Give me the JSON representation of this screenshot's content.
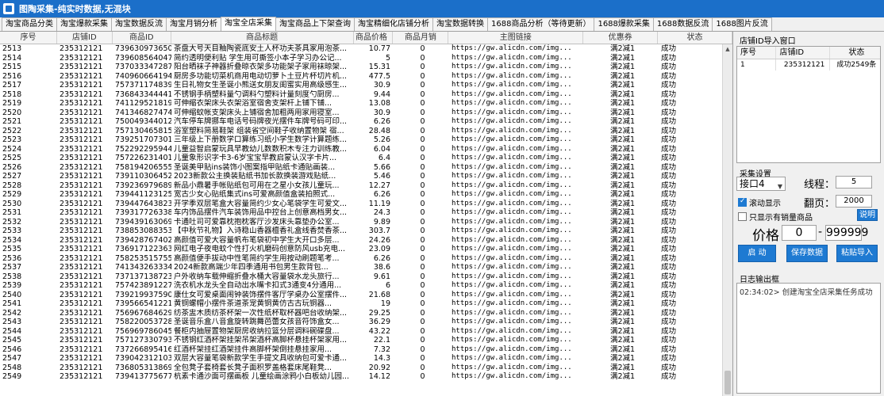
{
  "window": {
    "title": "图陶采集-纯实时数据,无混块"
  },
  "tabs": [
    "淘宝商品分类",
    "淘宝爆款采集",
    "淘宝数据反流",
    "淘宝月销分析",
    "淘宝全店采集",
    "淘宝商品上下架查询",
    "淘宝精细化店铺分析",
    "淘宝数据转换",
    "1688商品分析（等待更新）",
    "1688爆款采集",
    "1688数据反流",
    "1688图片反流"
  ],
  "grid": {
    "columns": [
      "序号",
      "店铺ID",
      "商品ID",
      "商品标题",
      "商品价格",
      "商品月销",
      "主图链接",
      "优惠券",
      "状态"
    ],
    "rows": [
      [
        "2513",
        "235312121",
        "739630973650",
        "茶盘大号天目釉陶瓷底安土人杯功夫茶具家用泡茶...",
        "10.77",
        "0",
        "https://gw.alicdn.com/img...",
        "满2减1",
        "成功"
      ],
      [
        "2514",
        "235312121",
        "739608564047",
        "简约透明便利贴 学生用可撕签小本子学习办公记...",
        "5",
        "0",
        "https://gw.alicdn.com/img...",
        "满2减1",
        "成功"
      ],
      [
        "2515",
        "235312121",
        "737033347287",
        "阳台晒袜子神器折叠晾衣架多功能架子家用袜晾架...",
        "15.31",
        "0",
        "https://gw.alicdn.com/img...",
        "满2减1",
        "成功"
      ],
      [
        "2516",
        "235312121",
        "740960664194",
        "厨房多功能切菜机商用电动切萝卜土豆片杯切片机...",
        "477.5",
        "0",
        "https://gw.alicdn.com/img...",
        "满2减1",
        "成功"
      ],
      [
        "2517",
        "235312121",
        "757371174839",
        "生日礼物女生圣诞小熊送女朋友闺蜜实用高级感生...",
        "30.9",
        "0",
        "https://gw.alicdn.com/img...",
        "满2减1",
        "成功"
      ],
      [
        "2518",
        "235312121",
        "736843344441",
        "不锈钢手柄塑料量勺调料勺塑料计量刻度勺厨房...",
        "9.44",
        "0",
        "https://gw.alicdn.com/img...",
        "满2减1",
        "成功"
      ],
      [
        "2519",
        "235312121",
        "741129521819",
        "可伸缩衣架床头衣架浴室宿舍支架杆上铺下铺...",
        "13.08",
        "0",
        "https://gw.alicdn.com/img...",
        "满2减1",
        "成功"
      ],
      [
        "2520",
        "235312121",
        "741346827474",
        "可伸缩蚊帐支架床头上铺宿舍加粗两用家用寝室...",
        "30.9",
        "0",
        "https://gw.alicdn.com/img...",
        "满2减1",
        "成功"
      ],
      [
        "2521",
        "235312121",
        "750049344012",
        "汽车停车牌挪车电话号码牌夜光摆件车牌号码可印...",
        "6.26",
        "0",
        "https://gw.alicdn.com/img...",
        "满2减1",
        "成功"
      ],
      [
        "2522",
        "235312121",
        "757130465815",
        "浴室塑料简易鞋架 组装省空间鞋子收纳置物架 宿...",
        "28.48",
        "0",
        "https://gw.alicdn.com/img...",
        "满2减1",
        "成功"
      ],
      [
        "2523",
        "235312121",
        "739251707301",
        "三年级上下册数学口算练习纸小学生数学计算题练...",
        "5.26",
        "0",
        "https://gw.alicdn.com/img...",
        "满2减1",
        "成功"
      ],
      [
        "2524",
        "235312121",
        "752292295944",
        "儿童益智启蒙玩具早教幼儿数数积木专注力训练教...",
        "6.04",
        "0",
        "https://gw.alicdn.com/img...",
        "满2减1",
        "成功"
      ],
      [
        "2525",
        "235312121",
        "757226231401",
        "儿童象形识字卡3-6岁宝宝早教启蒙认汉字卡片...",
        "6.4",
        "0",
        "https://gw.alicdn.com/img...",
        "满2减1",
        "成功"
      ],
      [
        "2526",
        "235312121",
        "758194206555",
        "圣诞美甲贴ins装饰小图案指甲贴纸卡通贴画装...",
        "5.66",
        "0",
        "https://gw.alicdn.com/img...",
        "满2减1",
        "成功"
      ],
      [
        "2527",
        "235312121",
        "739110306452",
        "2023新款公主换装贴纸书加长款换装游戏贴纸...",
        "5.46",
        "0",
        "https://gw.alicdn.com/img...",
        "满2减1",
        "成功"
      ],
      [
        "2528",
        "235312121",
        "739236979689",
        "新品小鼎暑手帐贴纸包可用在之星小女孩儿童玩...",
        "12.27",
        "0",
        "https://gw.alicdn.com/img...",
        "满2减1",
        "成功"
      ],
      [
        "2529",
        "235312121",
        "739441123125",
        "宽古少女心贴纸集式ins可爱高颜值盒装拍照式...",
        "6.26",
        "0",
        "https://gw.alicdn.com/img...",
        "满2减1",
        "成功"
      ],
      [
        "2530",
        "235312121",
        "739447643823",
        "开学季双层笔盒大容量简约少女心笔袋学生可爱文...",
        "11.19",
        "0",
        "https://gw.alicdn.com/img...",
        "满2减1",
        "成功"
      ],
      [
        "2531",
        "235312121",
        "739317726338",
        "车内饰品摆件汽车装饰用品中控台上创意高档男女...",
        "24.3",
        "0",
        "https://gw.alicdn.com/img...",
        "满2减1",
        "成功"
      ],
      [
        "2532",
        "235312121",
        "739439163069",
        "卡通吐司可爱靠枕抱枕客厅沙发床头靠垫办公室...",
        "9.89",
        "0",
        "https://gw.alicdn.com/img...",
        "满2减1",
        "成功"
      ],
      [
        "2533",
        "235312121",
        "738853088353",
        "【中秋节礼物】入诗稳山香器檀香礼盒线香焚香茶...",
        "303.7",
        "0",
        "https://gw.alicdn.com/img...",
        "满2减1",
        "成功"
      ],
      [
        "2534",
        "235312121",
        "739428767402",
        "高颜值可爱大容量帆布笔袋初中学生大开口多层...",
        "24.26",
        "0",
        "https://gw.alicdn.com/img...",
        "满2减1",
        "成功"
      ],
      [
        "2535",
        "235312121",
        "736917122363",
        "网红电子夜电蚊个性打火机磨码创意防风usb充电...",
        "23.09",
        "0",
        "https://gw.alicdn.com/img...",
        "满2减1",
        "成功"
      ],
      [
        "2536",
        "235312121",
        "758253515755",
        "高颜值便手拔动中性笔简约学生用按动刷题笔考...",
        "6.26",
        "0",
        "https://gw.alicdn.com/img...",
        "满2减1",
        "成功"
      ],
      [
        "2537",
        "235312121",
        "741343263334",
        "2024新款高端少年四季通用书包男生款背包...",
        "38.6",
        "0",
        "https://gw.alicdn.com/img...",
        "满2减1",
        "成功"
      ],
      [
        "2538",
        "235312121",
        "737137138723",
        "户外收纳车载伸缩折叠水桶大容量袋水龙头旅行...",
        "9.61",
        "0",
        "https://gw.alicdn.com/img...",
        "满2减1",
        "成功"
      ],
      [
        "2539",
        "235312121",
        "757423891227",
        "洗衣机水龙头全自动出水嘴卡扣式3通变4分通用...",
        "6",
        "0",
        "https://gw.alicdn.com/img...",
        "满2减1",
        "成功"
      ],
      [
        "2540",
        "235312121",
        "739219937590",
        "康仕女可爱桌面闹钟装饰摆件客厅学桌办公室摆件...",
        "21.68",
        "0",
        "https://gw.alicdn.com/img...",
        "满2减1",
        "成功"
      ],
      [
        "2541",
        "235312121",
        "739566541221",
        "黄铜螺帽小摆件茶道茶宠黄铜黄仿古古玩铜器...",
        "19",
        "0",
        "https://gw.alicdn.com/img...",
        "满2减1",
        "成功"
      ],
      [
        "2542",
        "235312121",
        "756967684629",
        "纺茶盅木质纺茶杯架一次性纸杯取杯器吧台收纳架...",
        "29.25",
        "0",
        "https://gw.alicdn.com/img...",
        "满2减1",
        "成功"
      ],
      [
        "2543",
        "235312121",
        "758220053728",
        "圣诞音乐盒八音盒旋转跳舞芭蕾女孩音符饰盒女...",
        "36.29",
        "0",
        "https://gw.alicdn.com/img...",
        "满2减1",
        "成功"
      ],
      [
        "2544",
        "235312121",
        "756969786045",
        "餐柜内抽屉置物架厨房收纳拉篮分层调料碗碟盘...",
        "43.22",
        "0",
        "https://gw.alicdn.com/img...",
        "满2减1",
        "成功"
      ],
      [
        "2545",
        "235312121",
        "757127330793",
        "不锈钢红酒杯架挂架吊架酒杯高脚杯悬挂杯架家用...",
        "22.1",
        "0",
        "https://gw.alicdn.com/img...",
        "满2减1",
        "成功"
      ],
      [
        "2546",
        "235312121",
        "737266895416",
        "红酒杯架挂红酒架挂件高脚杯架倒挂悬挂家用...",
        "7.32",
        "0",
        "https://gw.alicdn.com/img...",
        "满2减1",
        "成功"
      ],
      [
        "2547",
        "235312121",
        "739042312103",
        "双层大容量笔袋新款学生手提文具收纳包可爱卡通...",
        "14.3",
        "0",
        "https://gw.alicdn.com/img...",
        "满2减1",
        "成功"
      ],
      [
        "2548",
        "235312121",
        "736805313869",
        "全包凳子套椅套长凳子面积罗盖格套床尾鞋凳...",
        "20.92",
        "0",
        "https://gw.alicdn.com/img...",
        "满2减1",
        "成功"
      ],
      [
        "2549",
        "235312121",
        "739413775677",
        "杭素卡通沙面可摆画板 儿童绘画涂鸦小白板幼儿园...",
        "14.12",
        "0",
        "https://gw.alicdn.com/img...",
        "满2减1",
        "成功"
      ]
    ]
  },
  "shop_import": {
    "label": "店铺ID导入窗口",
    "columns": [
      "序号",
      "店铺ID",
      "状态"
    ],
    "rows": [
      [
        "1",
        "235312121",
        "成功2549条"
      ]
    ]
  },
  "settings": {
    "label": "采集设置",
    "port": "接口4",
    "threads_label": "线程：",
    "threads": "5",
    "page_label": "翻页：",
    "page": "2000",
    "scroll_display": "滚动显示",
    "only_sales": "只显示有销量商品",
    "explain_button": "说明",
    "price_label": "价格",
    "price_min": "0",
    "price_sep": "-",
    "price_max": "999999",
    "start_button": "启 动",
    "save_button": "保存数据",
    "paste_button": "粘贴导入"
  },
  "log": {
    "label": "日志输出框",
    "lines": [
      "02:34:02> 创建淘宝全店采集任务成功"
    ]
  },
  "colors": {
    "titlebar": "#1b6fc9",
    "accent": "#1e7ad2"
  }
}
